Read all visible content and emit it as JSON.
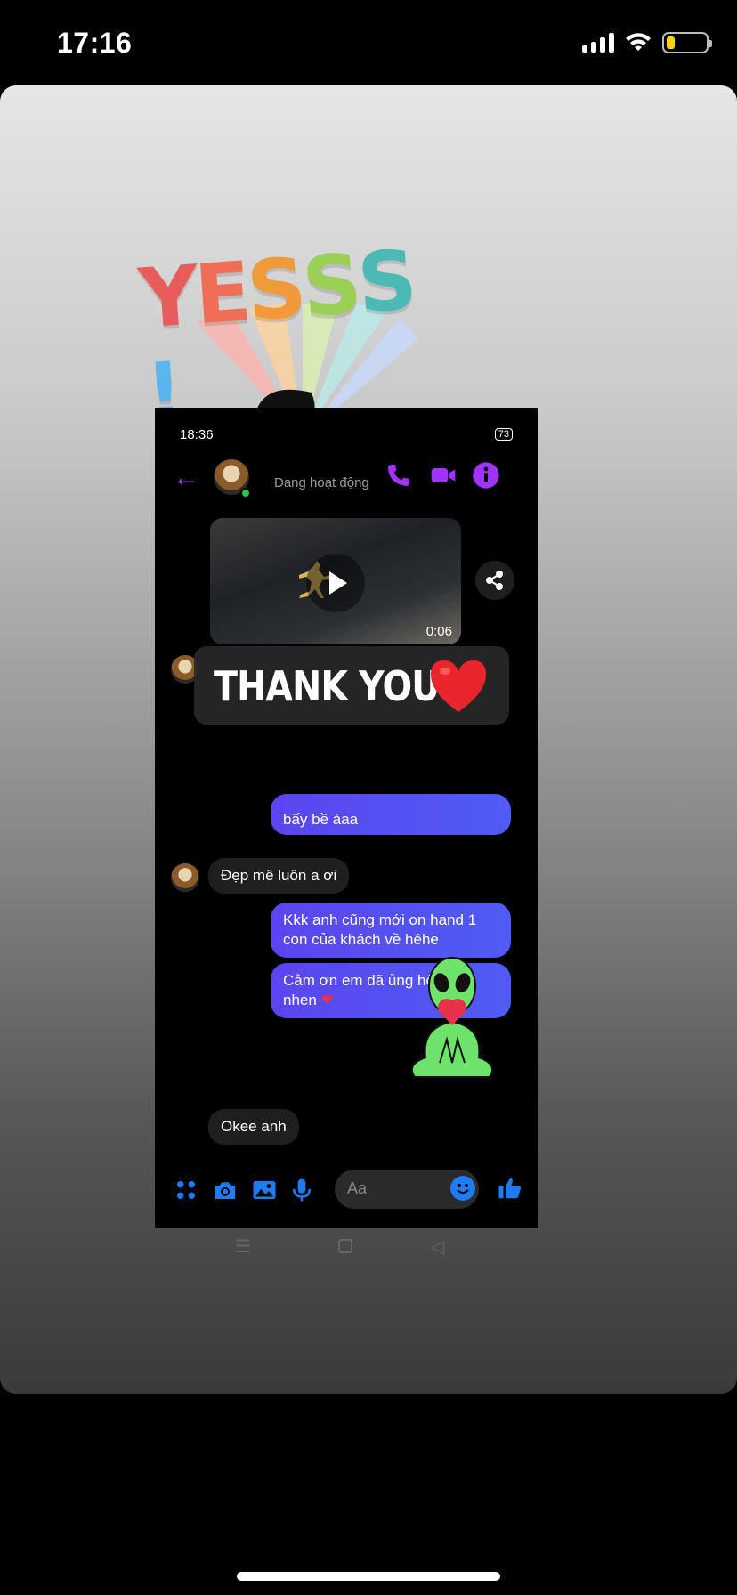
{
  "ios_status": {
    "time": "17:16"
  },
  "sticker": {
    "text": "YESSS!"
  },
  "messenger": {
    "status_time": "18:36",
    "battery": "73",
    "active_status": "Đang hoạt động",
    "video_duration": "0:06",
    "messages": [
      {
        "id": "m1",
        "side": "out",
        "text": "bấy bề àaa"
      },
      {
        "id": "m2",
        "side": "in",
        "text": "Đẹp mê luôn a ơi"
      },
      {
        "id": "m3",
        "side": "out",
        "text": "Kkk anh cũng mới on hand 1 con của khách về hêhe"
      },
      {
        "id": "m4",
        "side": "out",
        "text": "Cảm ơn em đã ủng hộ anh nhen"
      },
      {
        "id": "m5",
        "side": "in",
        "text": "Okee anh"
      }
    ],
    "composer_placeholder": "Aa"
  },
  "overlay": {
    "thank_text": "THANK YOU"
  },
  "colors": {
    "accent": "#a033ff",
    "bubble_out": "#5b45f0",
    "composer_icons": "#1f7bf2"
  }
}
